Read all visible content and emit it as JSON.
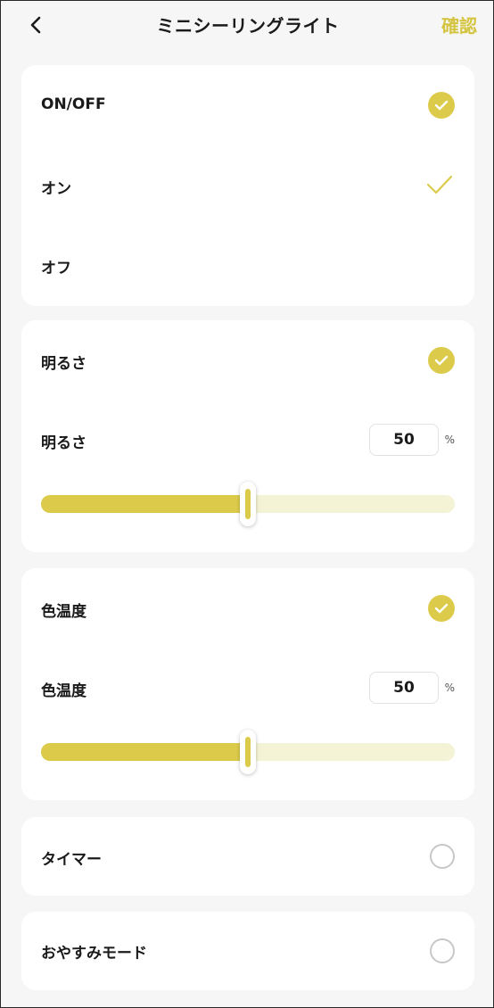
{
  "header": {
    "title": "ミニシーリングライト",
    "confirm_label": "確認"
  },
  "power": {
    "label": "ON/OFF",
    "options": [
      {
        "label": "オン",
        "selected": true
      },
      {
        "label": "オフ",
        "selected": false
      }
    ]
  },
  "brightness": {
    "section_label": "明るさ",
    "label": "明るさ",
    "value": "50",
    "unit": "%",
    "fraction": 0.5
  },
  "color_temp": {
    "section_label": "色温度",
    "label": "色温度",
    "value": "50",
    "unit": "%",
    "fraction": 0.5
  },
  "timer": {
    "label": "タイマー"
  },
  "sleep": {
    "label": "おやすみモード"
  },
  "colors": {
    "accent": "#dccb4b",
    "track": "#f5f3d5"
  }
}
